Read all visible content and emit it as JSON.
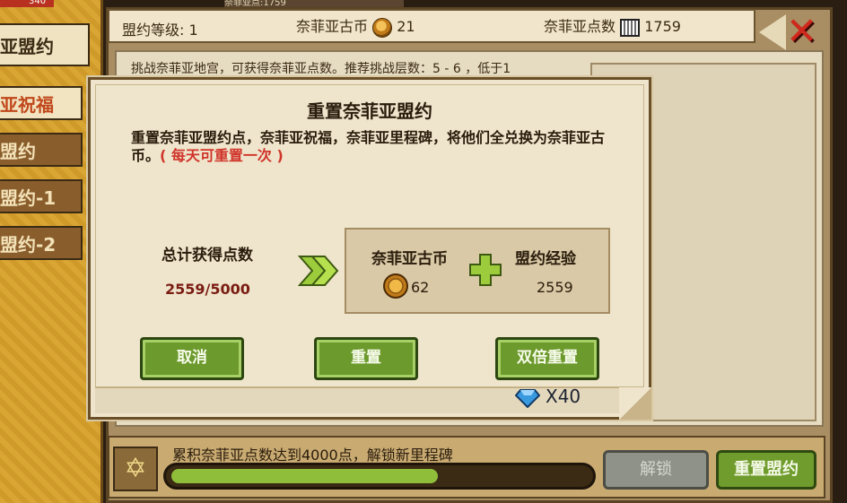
{
  "status_strip": {
    "text": "奈菲亚点:1759"
  },
  "sidebar": {
    "top_value": "340",
    "tabs": [
      {
        "label": "亚盟约",
        "active": true
      },
      {
        "label": "亚祝福",
        "highlight": true
      },
      {
        "label": "盟约"
      },
      {
        "label": "盟约-1"
      },
      {
        "label": "盟约-2"
      }
    ]
  },
  "topbar": {
    "level_label": "盟约等级:",
    "level_value": "1",
    "coin_label": "奈菲亚古币",
    "coin_value": "21",
    "points_label": "奈菲亚点数",
    "points_value": "1759"
  },
  "content": {
    "text": "挑战奈菲亚地宫，可获得奈菲亚点数。推荐挑战层数：5 - 6 ，低于1"
  },
  "bottom": {
    "milestone_text": "累积奈菲亚点数达到4000点，解锁新里程碑",
    "progress_fraction": 0.64,
    "unlock_label": "解锁",
    "reset_label": "重置盟约"
  },
  "dialog": {
    "title": "重置奈菲亚盟约",
    "desc_main": "重置奈菲亚盟约点，奈菲亚祝福，奈菲亚里程碑，将他们全兑换为奈菲亚古币。",
    "desc_note": "( 每天可重置一次 )",
    "total_label": "总计获得点数",
    "total_value": "2559/5000",
    "reward_coin_label": "奈菲亚古币",
    "reward_coin_value": "62",
    "reward_exp_label": "盟约经验",
    "reward_exp_value": "2559",
    "cancel_label": "取消",
    "reset_label": "重置",
    "double_reset_label": "双倍重置",
    "gem_cost": "X40"
  },
  "colors": {
    "accent_green": "#6c9a2c",
    "close_red": "#d0281c",
    "note_red": "#d0342a"
  }
}
